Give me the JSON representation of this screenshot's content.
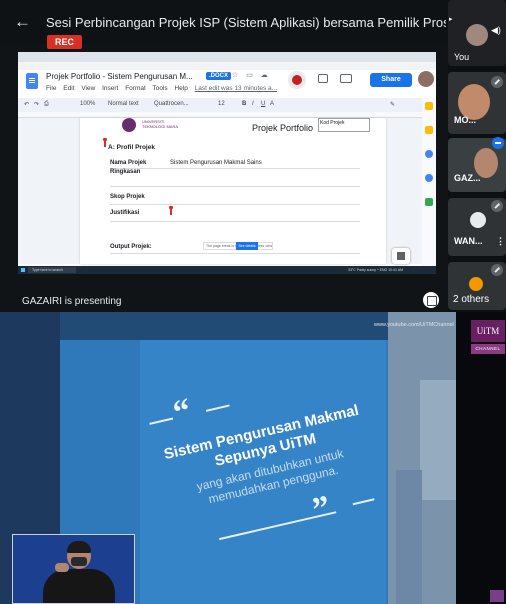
{
  "meeting": {
    "title": "Sesi Perbincangan Projek ISP (Sistem Aplikasi) bersama Pemilik Proses: Si...",
    "rec_label": "REC",
    "presenting_text": "GAZAIRI is presenting"
  },
  "doc": {
    "title": "Projek Portfolio - Sistem Pengurusan M...",
    "format_badge": ".DOCX",
    "menu": [
      "File",
      "Edit",
      "View",
      "Insert",
      "Format",
      "Tools",
      "Help"
    ],
    "last_edit": "Last edit was 13 minutes a...",
    "share_label": "Share",
    "toolbar": {
      "zoom": "100%",
      "style": "Normal text",
      "font": "Quattrocen...",
      "font_size": "12",
      "bold": "B",
      "italic": "I",
      "underline": "U",
      "text_color": "A"
    },
    "header": {
      "university": "UNIVERSITI TEKNOLOGI MARA",
      "page_title": "Projek Portfolio",
      "box_label": "Kod Projek"
    },
    "section_title": "A: Profil Projek",
    "fields": [
      {
        "label": "Nama Projek",
        "value": "Sistem Pengurusan Makmal Sains"
      },
      {
        "label": "Ringkasan",
        "value": ""
      },
      {
        "label": "Skop Projek",
        "value": ""
      },
      {
        "label": "Justifikasi",
        "value": ""
      },
      {
        "label": "Output Projek:",
        "value": ""
      }
    ],
    "tooltip": "The page break is hidden in pageless view",
    "tooltip_button": "See details"
  },
  "taskbar": {
    "search_text": "Type here to search",
    "tray_text": "33°C Partly sunny  ^  ENG  10:41 AM"
  },
  "participants": {
    "you_label": "You",
    "tiles": [
      {
        "name": "MO..."
      },
      {
        "name": "GAZ..."
      },
      {
        "name": "WAN..."
      }
    ],
    "others_label": "2 others"
  },
  "broadcast": {
    "url": "www.youtube.com/UiTMChannel",
    "logo_text": "UiTM",
    "channel_label": "CHANNEL",
    "quote_open": "“",
    "quote_close": "”",
    "headline": "Sistem Pengurusan Makmal Sepunya UiTM",
    "subline": "yang akan ditubuhkan untuk memudahkan pengguna."
  },
  "colors": {
    "rec_red": "#d93025",
    "docs_blue": "#1a73e8",
    "broadcast_blue": "#2f78ba",
    "uitm_purple": "#6a1f63"
  }
}
